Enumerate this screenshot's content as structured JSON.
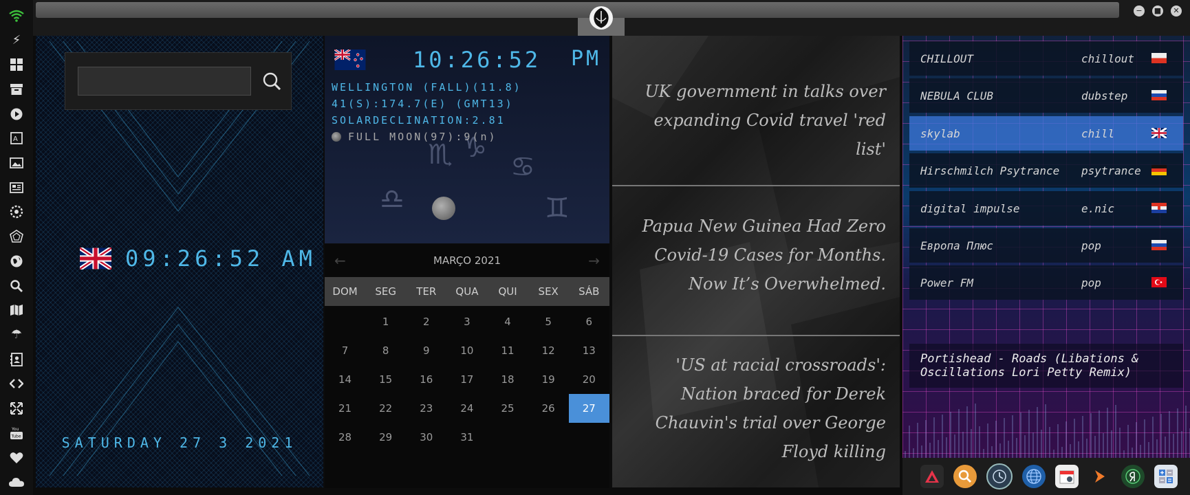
{
  "sidebar": {
    "icons": [
      "wifi-icon",
      "lightning-icon",
      "windows-icon",
      "archive-icon",
      "play-icon",
      "translate-icon",
      "image-icon",
      "news-icon",
      "settings-icon",
      "crystal-icon",
      "globe-icon",
      "search-icon",
      "map-icon",
      "umbrella-icon",
      "contacts-icon",
      "code-icon",
      "expand-icon",
      "youtube-icon",
      "heart-icon",
      "cloud-icon"
    ]
  },
  "window": {
    "minimize": "−",
    "maximize": "■",
    "close": "✕"
  },
  "search": {
    "value": ""
  },
  "local_clock": {
    "time": "09:26:52 AM",
    "date": "SATURDAY 27 3 2021"
  },
  "world_clock": {
    "time": "10:26:52",
    "ampm": "PM",
    "line1": "WELLINGTON (FALL)(11.8)",
    "line2": "41(S):174.7(E) (GMT13)",
    "line3": "SOLARDECLINATION:2.81",
    "moon": "FULL MOON(97):9(n)"
  },
  "calendar": {
    "month": "MARÇO 2021",
    "prev": "←",
    "next": "→",
    "days": [
      "DOM",
      "SEG",
      "TER",
      "QUA",
      "QUI",
      "SEX",
      "SÁB"
    ],
    "weeks": [
      [
        "",
        "1",
        "2",
        "3",
        "4",
        "5",
        "6"
      ],
      [
        "7",
        "8",
        "9",
        "10",
        "11",
        "12",
        "13"
      ],
      [
        "14",
        "15",
        "16",
        "17",
        "18",
        "19",
        "20"
      ],
      [
        "21",
        "22",
        "23",
        "24",
        "25",
        "26",
        "27"
      ],
      [
        "28",
        "29",
        "30",
        "31",
        "",
        "",
        ""
      ]
    ],
    "today": "27"
  },
  "news": [
    "UK government in talks over expanding Covid travel 'red list'",
    "Papua New Guinea Had Zero Covid-19 Cases for Months. Now It’s Overwhelmed.",
    "'US at racial crossroads': Nation braced for Derek Chauvin's trial over George Floyd killing"
  ],
  "radio": {
    "stations": [
      {
        "name": "CHILLOUT",
        "genre": "chillout",
        "flag": "poland"
      },
      {
        "name": "NEBULA CLUB",
        "genre": "dubstep",
        "flag": "russia"
      },
      {
        "name": "skylab",
        "genre": "chill",
        "flag": "uk"
      },
      {
        "name": "Hirschmilch Psytrance",
        "genre": "psytrance",
        "flag": "germany"
      },
      {
        "name": "digital impulse",
        "genre": "e.nic",
        "flag": "croatia"
      },
      {
        "name": "Европа Плюс",
        "genre": "pop",
        "flag": "russia"
      },
      {
        "name": "Power FM",
        "genre": "pop",
        "flag": "turkey"
      }
    ],
    "active_index": 2,
    "now_playing": "Portishead - Roads (Libations & Oscillations Lori Petty Remix)"
  },
  "dock": {
    "icons": [
      "app-launcher-icon",
      "search-icon",
      "clock-icon",
      "globe-icon",
      "calendar-icon",
      "forward-icon",
      "yandex-icon",
      "calculator-icon"
    ]
  },
  "colors": {
    "accent": "#4fb8e8",
    "today": "#4a90d9",
    "active_station": "#3c78dc"
  }
}
